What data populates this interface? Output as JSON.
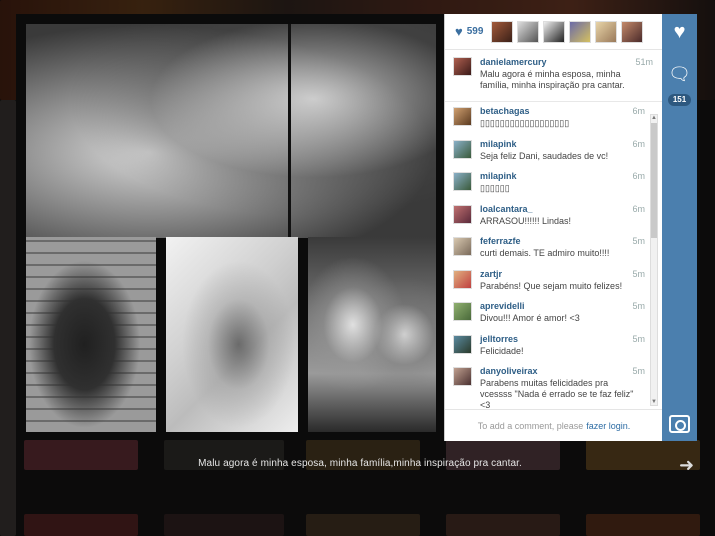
{
  "post": {
    "caption": "Malu agora é minha esposa, minha família,minha inspiração pra cantar.",
    "likes_count": "599",
    "comment_count": "151"
  },
  "comments": [
    {
      "user": "danielamercury",
      "time": "51m",
      "text": "Malu agora é minha esposa, minha família, minha inspiração pra cantar."
    },
    {
      "user": "betachagas",
      "time": "6m",
      "text": "▯▯▯▯▯▯▯▯▯▯▯▯▯▯▯▯▯▯"
    },
    {
      "user": "milapink",
      "time": "6m",
      "text": "Seja feliz Dani, saudades de vc!"
    },
    {
      "user": "milapink",
      "time": "6m",
      "text": "▯▯▯▯▯▯"
    },
    {
      "user": "loalcantara_",
      "time": "6m",
      "text": "ARRASOU!!!!!! Lindas!"
    },
    {
      "user": "feferrazfe",
      "time": "5m",
      "text": "curti demais. TE admiro muito!!!!"
    },
    {
      "user": "zartjr",
      "time": "5m",
      "text": "Parabéns! Que sejam muito felizes!"
    },
    {
      "user": "aprevidelli",
      "time": "5m",
      "text": "Divou!!! Amor é amor! <3"
    },
    {
      "user": "jelltorres",
      "time": "5m",
      "text": "Felicidade!"
    },
    {
      "user": "danyoliveirax",
      "time": "5m",
      "text": "Parabens muitas felicidades pra vcessss \"Nada é errado se te faz feliz\" <3"
    }
  ],
  "add_comment": {
    "prompt": "To add a comment, please",
    "link": "fazer login."
  },
  "icons": {
    "like": "heart-icon",
    "comment": "speech-bubble-icon",
    "instagram": "camera-icon",
    "next": "arrow-right-icon"
  },
  "colors": {
    "accent": "#4b7fae",
    "username": "#2e5e86",
    "link": "#2e6da4"
  }
}
